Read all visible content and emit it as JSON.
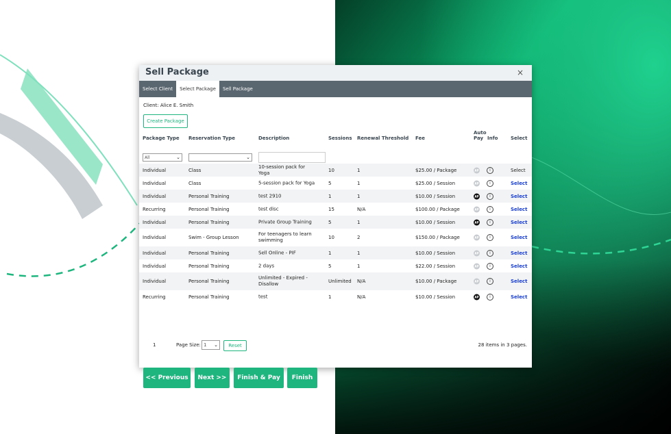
{
  "dialog": {
    "title": "Sell Package",
    "close_glyph": "×",
    "tabs": [
      {
        "label": "Select Client",
        "active": false
      },
      {
        "label": "Select Package",
        "active": true
      },
      {
        "label": "Sell Package",
        "active": false
      }
    ],
    "client_text": "Client: Alice E. Smith",
    "create_package_label": "Create Package"
  },
  "table": {
    "columns": {
      "package_type": "Package Type",
      "reservation_type": "Reservation Type",
      "description": "Description",
      "sessions": "Sessions",
      "renewal_threshold": "Renewal Threshold",
      "fee": "Fee",
      "auto_pay_1": "Auto",
      "auto_pay_2": "Pay",
      "info": "Info",
      "select": "Select"
    },
    "filters": {
      "package_type_value": "All",
      "reservation_type_value": "",
      "description_value": ""
    },
    "rows": [
      {
        "package_type": "Individual",
        "reservation_type": "Class",
        "description": "10-session pack for Yoga",
        "sessions": "10",
        "renewal": "1",
        "fee": "$25.00 / Package",
        "auto_pay": false,
        "select": "Select",
        "select_link": false
      },
      {
        "package_type": "Individual",
        "reservation_type": "Class",
        "description": "5-session pack for Yoga",
        "sessions": "5",
        "renewal": "1",
        "fee": "$25.00 / Session",
        "auto_pay": false,
        "select": "Select",
        "select_link": true
      },
      {
        "package_type": "Individual",
        "reservation_type": "Personal Training",
        "description": "test 2910",
        "sessions": "1",
        "renewal": "1",
        "fee": "$10.00 / Session",
        "auto_pay": true,
        "select": "Select",
        "select_link": true
      },
      {
        "package_type": "Recurring",
        "reservation_type": "Personal Training",
        "description": "test disc",
        "sessions": "15",
        "renewal": "N/A",
        "fee": "$100.00 / Package",
        "auto_pay": false,
        "select": "Select",
        "select_link": true
      },
      {
        "package_type": "Individual",
        "reservation_type": "Personal Training",
        "description": "Private Group Training",
        "sessions": "5",
        "renewal": "1",
        "fee": "$10.00 / Session",
        "auto_pay": true,
        "select": "Select",
        "select_link": true
      },
      {
        "package_type": "Individual",
        "reservation_type": "Swim - Group Lesson",
        "description": "For teenagers to learn swimming",
        "sessions": "10",
        "renewal": "2",
        "fee": "$150.00 / Package",
        "auto_pay": false,
        "select": "Select",
        "select_link": true
      },
      {
        "package_type": "Individual",
        "reservation_type": "Personal Training",
        "description": "Sell Online - PIF",
        "sessions": "1",
        "renewal": "1",
        "fee": "$10.00 / Session",
        "auto_pay": false,
        "select": "Select",
        "select_link": true
      },
      {
        "package_type": "Individual",
        "reservation_type": "Personal Training",
        "description": "2 days",
        "sessions": "5",
        "renewal": "1",
        "fee": "$22.00 / Session",
        "auto_pay": false,
        "select": "Select",
        "select_link": true
      },
      {
        "package_type": "Individual",
        "reservation_type": "Personal Training",
        "description": "Unlimited - Expired - Disallow",
        "sessions": "Unlimited",
        "renewal": "N/A",
        "fee": "$10.00 / Package",
        "auto_pay": false,
        "select": "Select",
        "select_link": true
      },
      {
        "package_type": "Recurring",
        "reservation_type": "Personal Training",
        "description": "test",
        "sessions": "1",
        "renewal": "N/A",
        "fee": "$10.00 / Session",
        "auto_pay": true,
        "select": "Select",
        "select_link": true
      }
    ],
    "auto_pay_badge": "AP",
    "info_glyph": "i"
  },
  "pager": {
    "current_page": "1",
    "page_size_label": "Page Size:",
    "page_size_value": "1",
    "reset_label": "Reset",
    "summary": "28 items in 3 pages."
  },
  "buttons": {
    "previous": "<< Previous",
    "next": "Next >>",
    "finish_pay": "Finish & Pay",
    "finish": "Finish"
  },
  "colors": {
    "accent": "#1fb57f",
    "tab_bar": "#5b6770",
    "link": "#1a3fd6"
  }
}
